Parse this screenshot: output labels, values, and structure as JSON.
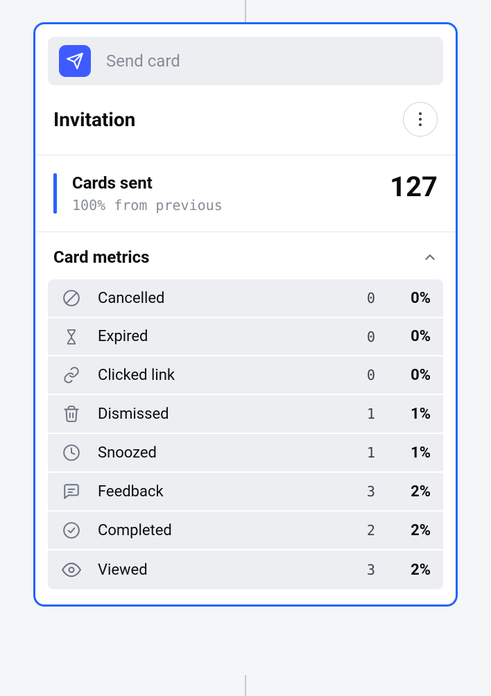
{
  "action": {
    "label": "Send card"
  },
  "title": "Invitation",
  "cards_sent": {
    "label": "Cards sent",
    "delta": "100% from previous",
    "count": "127"
  },
  "metrics_title": "Card metrics",
  "metrics": [
    {
      "icon": "cancel",
      "label": "Cancelled",
      "count": "0",
      "pct": "0%"
    },
    {
      "icon": "expired",
      "label": "Expired",
      "count": "0",
      "pct": "0%"
    },
    {
      "icon": "link",
      "label": "Clicked link",
      "count": "0",
      "pct": "0%"
    },
    {
      "icon": "trash",
      "label": "Dismissed",
      "count": "1",
      "pct": "1%"
    },
    {
      "icon": "clock",
      "label": "Snoozed",
      "count": "1",
      "pct": "1%"
    },
    {
      "icon": "feedback",
      "label": "Feedback",
      "count": "3",
      "pct": "2%"
    },
    {
      "icon": "check",
      "label": "Completed",
      "count": "2",
      "pct": "2%"
    },
    {
      "icon": "eye",
      "label": "Viewed",
      "count": "3",
      "pct": "2%"
    }
  ]
}
